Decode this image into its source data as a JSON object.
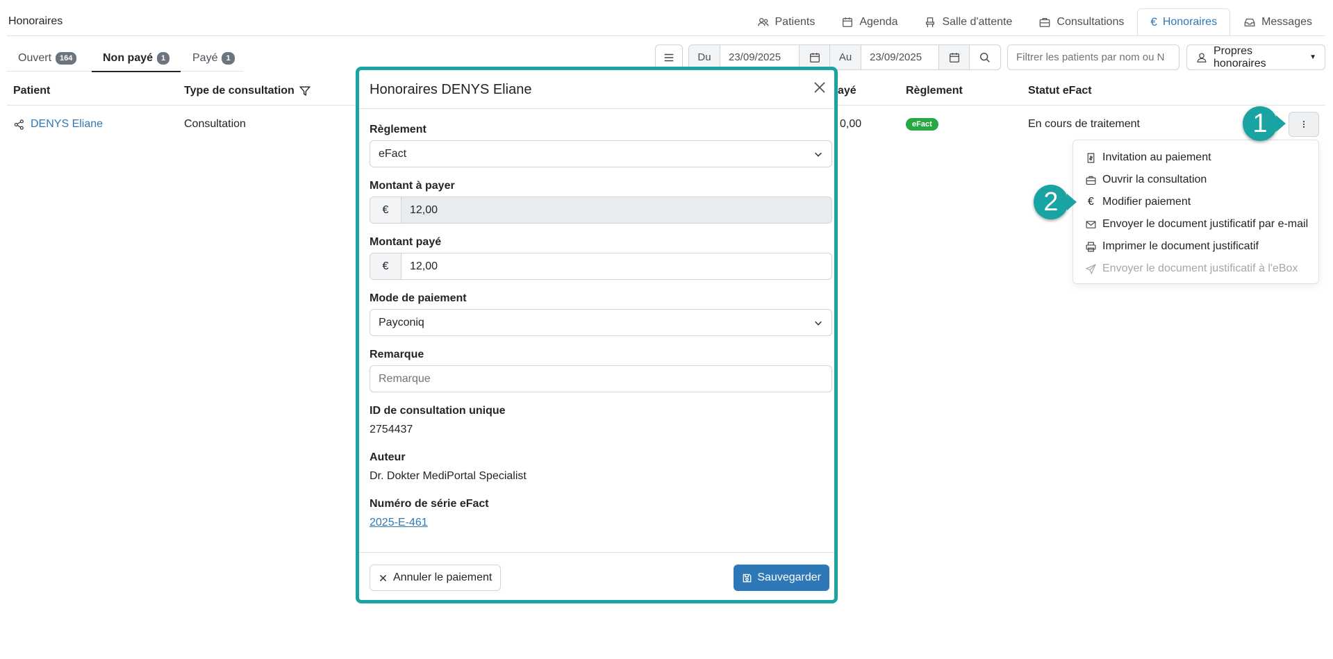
{
  "app": {
    "title": "Honoraires"
  },
  "nav": {
    "tabs": [
      {
        "label": "Patients",
        "icon": "users-icon"
      },
      {
        "label": "Agenda",
        "icon": "calendar-icon"
      },
      {
        "label": "Salle d'attente",
        "icon": "chair-icon"
      },
      {
        "label": "Consultations",
        "icon": "briefcase-icon"
      },
      {
        "label": "Honoraires",
        "icon": "euro-icon",
        "active": true
      },
      {
        "label": "Messages",
        "icon": "inbox-icon"
      }
    ]
  },
  "subtabs": [
    {
      "label": "Ouvert",
      "count": "164"
    },
    {
      "label": "Non payé",
      "count": "1",
      "active": true
    },
    {
      "label": "Payé",
      "count": "1"
    }
  ],
  "toolbar": {
    "from_label": "Du",
    "from_date": "23/09/2025",
    "to_label": "Au",
    "to_date": "23/09/2025",
    "filter_placeholder": "Filtrer les patients par nom ou N",
    "own_fees_label": "Propres honoraires"
  },
  "table": {
    "headers": {
      "patient": "Patient",
      "type": "Type de consultation",
      "paid": "ayé",
      "reglement": "Règlement",
      "status": "Statut eFact"
    },
    "row": {
      "patient": "DENYS Eliane",
      "type": "Consultation",
      "paid": "0,00",
      "reglement": "eFact",
      "status": "En cours de traitement"
    }
  },
  "menu": {
    "items": [
      {
        "label": "Invitation au paiement",
        "icon": "invoice-icon"
      },
      {
        "label": "Ouvrir la consultation",
        "icon": "briefcase-icon"
      },
      {
        "label": "Modifier paiement",
        "icon": "euro-icon"
      },
      {
        "label": "Envoyer le document justificatif par e-mail",
        "icon": "envelope-icon"
      },
      {
        "label": "Imprimer le document justificatif",
        "icon": "printer-icon"
      },
      {
        "label": "Envoyer le document justificatif à l'eBox",
        "icon": "send-icon",
        "disabled": true
      }
    ]
  },
  "callouts": {
    "one": "1",
    "two": "2"
  },
  "modal": {
    "title": "Honoraires DENYS Eliane",
    "reglement_label": "Règlement",
    "reglement_value": "eFact",
    "amount_due_label": "Montant à payer",
    "amount_due_currency": "€",
    "amount_due_value": "12,00",
    "amount_paid_label": "Montant payé",
    "amount_paid_currency": "€",
    "amount_paid_value": "12,00",
    "payment_mode_label": "Mode de paiement",
    "payment_mode_value": "Payconiq",
    "remark_label": "Remarque",
    "remark_placeholder": "Remarque",
    "consultation_id_label": "ID de consultation unique",
    "consultation_id_value": "2754437",
    "author_label": "Auteur",
    "author_value": "Dr. Dokter MediPortal Specialist",
    "serial_label": "Numéro de série eFact",
    "serial_value": "2025-E-461",
    "cancel_label": "Annuler le paiement",
    "save_label": "Sauvegarder"
  },
  "colors": {
    "accent": "#2f78b7",
    "callout": "#1aa3a3",
    "efact_badge": "#28a745",
    "badge": "#6c757d"
  }
}
